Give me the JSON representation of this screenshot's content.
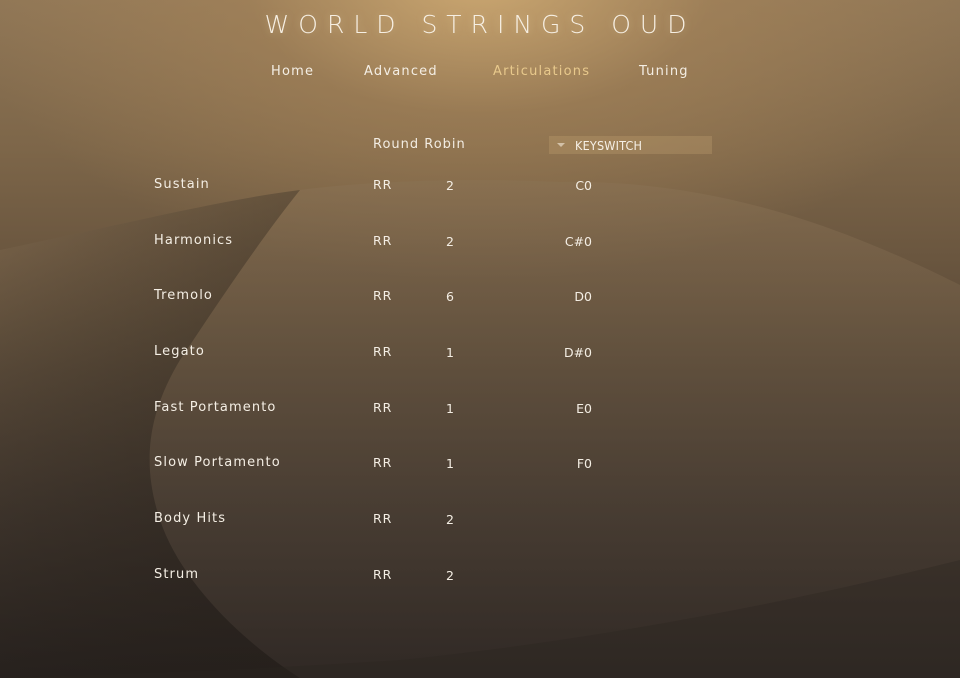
{
  "title": "WORLD STRINGS OUD",
  "nav": {
    "tabs": [
      {
        "label": "Home",
        "active": false
      },
      {
        "label": "Advanced",
        "active": false
      },
      {
        "label": "Articulations",
        "active": true
      },
      {
        "label": "Tuning",
        "active": false
      }
    ]
  },
  "table": {
    "round_robin_header": "Round Robin",
    "keyswitch_select": "KEYSWITCH",
    "rows": [
      {
        "name": "Sustain",
        "rr_label": "RR",
        "rr_value": "2",
        "keyswitch": "C0"
      },
      {
        "name": "Harmonics",
        "rr_label": "RR",
        "rr_value": "2",
        "keyswitch": "C#0"
      },
      {
        "name": "Tremolo",
        "rr_label": "RR",
        "rr_value": "6",
        "keyswitch": "D0"
      },
      {
        "name": "Legato",
        "rr_label": "RR",
        "rr_value": "1",
        "keyswitch": "D#0"
      },
      {
        "name": "Fast Portamento",
        "rr_label": "RR",
        "rr_value": "1",
        "keyswitch": "E0"
      },
      {
        "name": "Slow Portamento",
        "rr_label": "RR",
        "rr_value": "1",
        "keyswitch": "F0"
      },
      {
        "name": "Body Hits",
        "rr_label": "RR",
        "rr_value": "2",
        "keyswitch": ""
      },
      {
        "name": "Strum",
        "rr_label": "RR",
        "rr_value": "2",
        "keyswitch": ""
      }
    ]
  },
  "colors": {
    "active_tab": "#e8c98c",
    "text": "#f4eee4"
  }
}
